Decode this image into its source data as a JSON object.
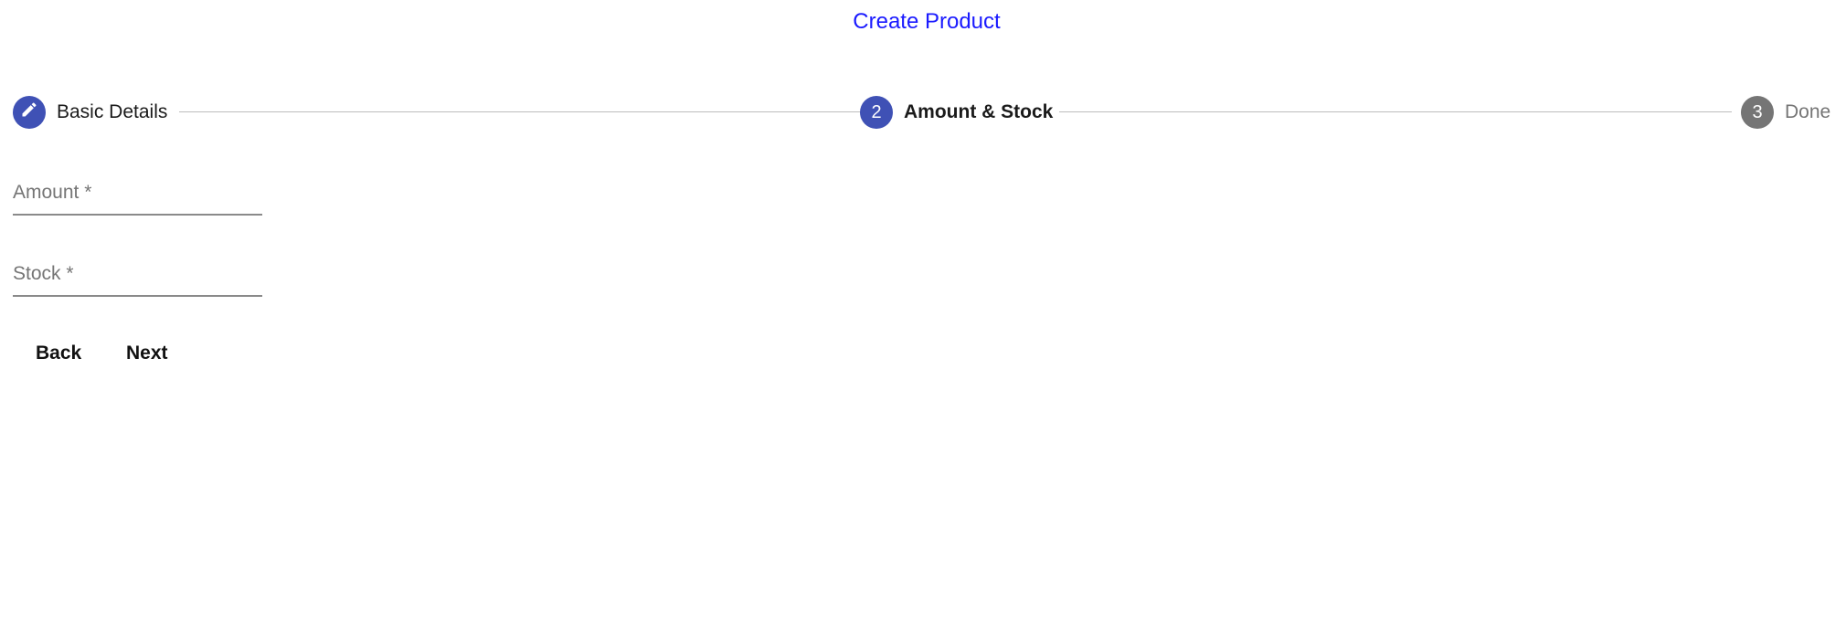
{
  "page": {
    "title": "Create Product"
  },
  "stepper": {
    "steps": [
      {
        "label": "Basic Details",
        "state": "completed",
        "icon": "pencil-icon"
      },
      {
        "label": "Amount & Stock",
        "state": "active",
        "number": "2"
      },
      {
        "label": "Done",
        "state": "inactive",
        "number": "3"
      }
    ]
  },
  "form": {
    "amount_label": "Amount *",
    "stock_label": "Stock *",
    "amount_value": "",
    "stock_value": ""
  },
  "actions": {
    "back_label": "Back",
    "next_label": "Next"
  },
  "colors": {
    "title": "#1a1aff",
    "active_step": "#3f51b5",
    "inactive_step": "#757575",
    "connector": "#bdbdbd"
  }
}
